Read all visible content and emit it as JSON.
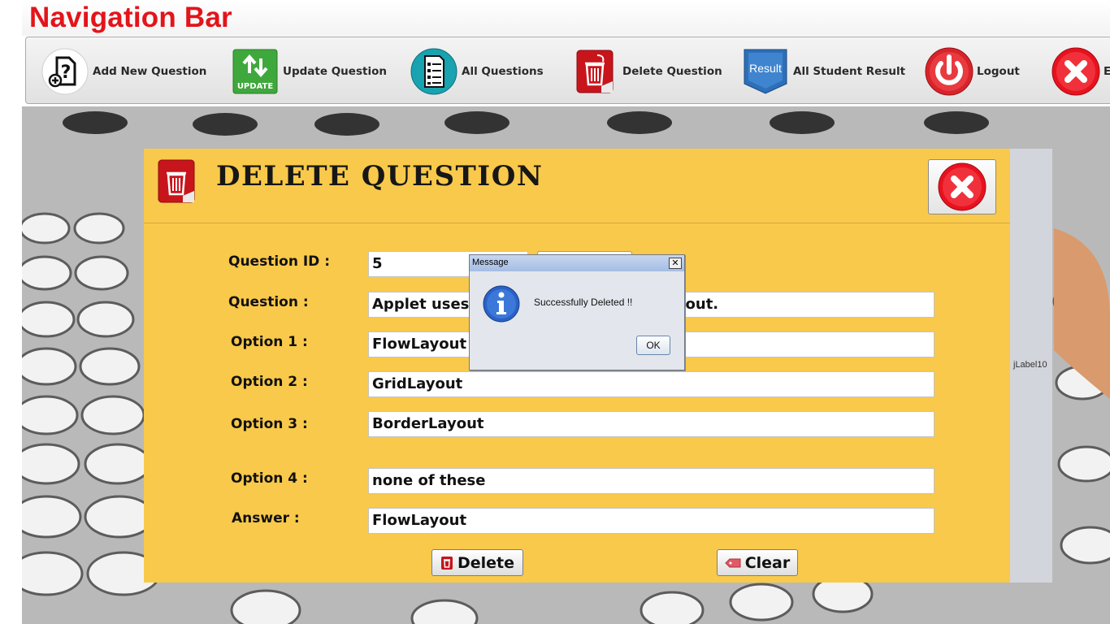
{
  "nav_title": "Navigation Bar",
  "toolbar": {
    "items": [
      {
        "label": "Add New Question",
        "icon": "add-question-icon"
      },
      {
        "label": "Update Question",
        "icon": "update-icon",
        "icon_text": "UPDATE"
      },
      {
        "label": "All Questions",
        "icon": "list-icon"
      },
      {
        "label": "Delete Question",
        "icon": "trash-icon"
      },
      {
        "label": "All Student Result",
        "icon": "result-icon",
        "icon_text": "Result"
      },
      {
        "label": "Logout",
        "icon": "power-icon"
      },
      {
        "label": "E",
        "icon": "exit-icon"
      }
    ]
  },
  "panel": {
    "heading": "DELETE QUESTION",
    "fields": [
      {
        "label": "Question ID :",
        "value": "5"
      },
      {
        "label": "Question :",
        "value": "Applet uses FlowLayout as default layout."
      },
      {
        "label": "Option 1 :",
        "value": "FlowLayout"
      },
      {
        "label": "Option 2 :",
        "value": "GridLayout"
      },
      {
        "label": "Option 3 :",
        "value": "BorderLayout"
      },
      {
        "label": "Option 4 :",
        "value": "none of these"
      },
      {
        "label": "Answer :",
        "value": "FlowLayout"
      }
    ],
    "delete_label": "Delete",
    "clear_label": "Clear",
    "side_label": "jLabel10"
  },
  "dialog": {
    "title": "Message",
    "close": "☒",
    "message": "Successfully Deleted !!",
    "ok_label": "OK"
  },
  "colors": {
    "title_red": "#e3141a",
    "panel_yellow": "#f9c94b",
    "exit_red": "#e8121f"
  }
}
